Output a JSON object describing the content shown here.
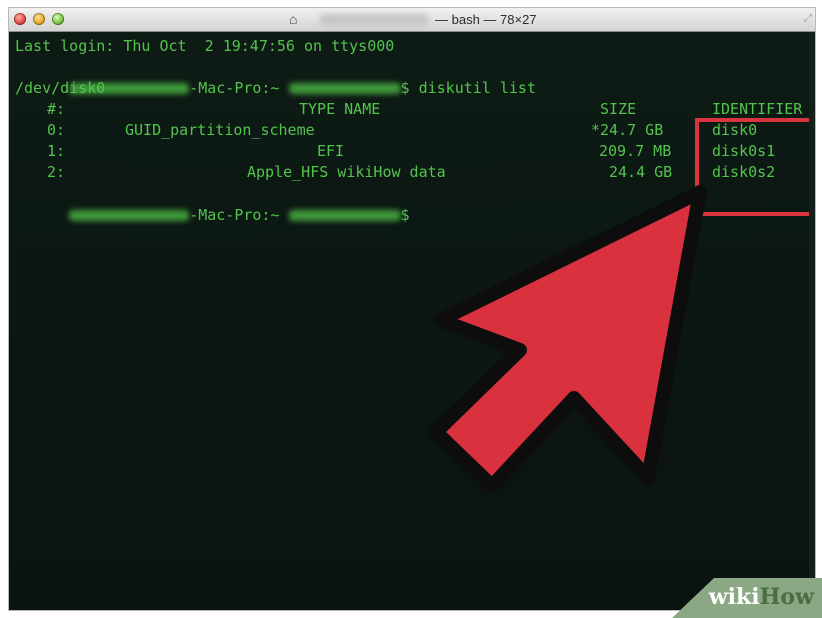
{
  "window": {
    "title": "— bash — 78×27",
    "home_icon": "home-icon",
    "resize_icon": "resize-icon"
  },
  "terminal": {
    "last_login": "Last login: Thu Oct  2 19:47:56 on ttys000",
    "prompt_suffix": "-Mac-Pro:~",
    "command_line": "$ diskutil list",
    "prompt_end": "$",
    "device": "/dev/disk0",
    "table": {
      "headers": {
        "num": "#:",
        "type_name": "TYPE NAME",
        "size": "SIZE",
        "identifier": "IDENTIFIER"
      },
      "rows": [
        {
          "num": "0:",
          "type_name": "GUID_partition_scheme",
          "size": "*24.7 GB",
          "identifier": "disk0"
        },
        {
          "num": "1:",
          "type_name": "EFI",
          "size": "209.7 MB",
          "identifier": "disk0s1"
        },
        {
          "num": "2:",
          "type_name": "Apple_HFS wikiHow data",
          "size": "24.4 GB",
          "identifier": "disk0s2"
        }
      ]
    }
  },
  "colors": {
    "terminal_text": "#54c34d",
    "terminal_bg": "#0c1410",
    "highlight": "#d9353f"
  },
  "watermark": {
    "wiki": "wiki",
    "how": "How"
  }
}
